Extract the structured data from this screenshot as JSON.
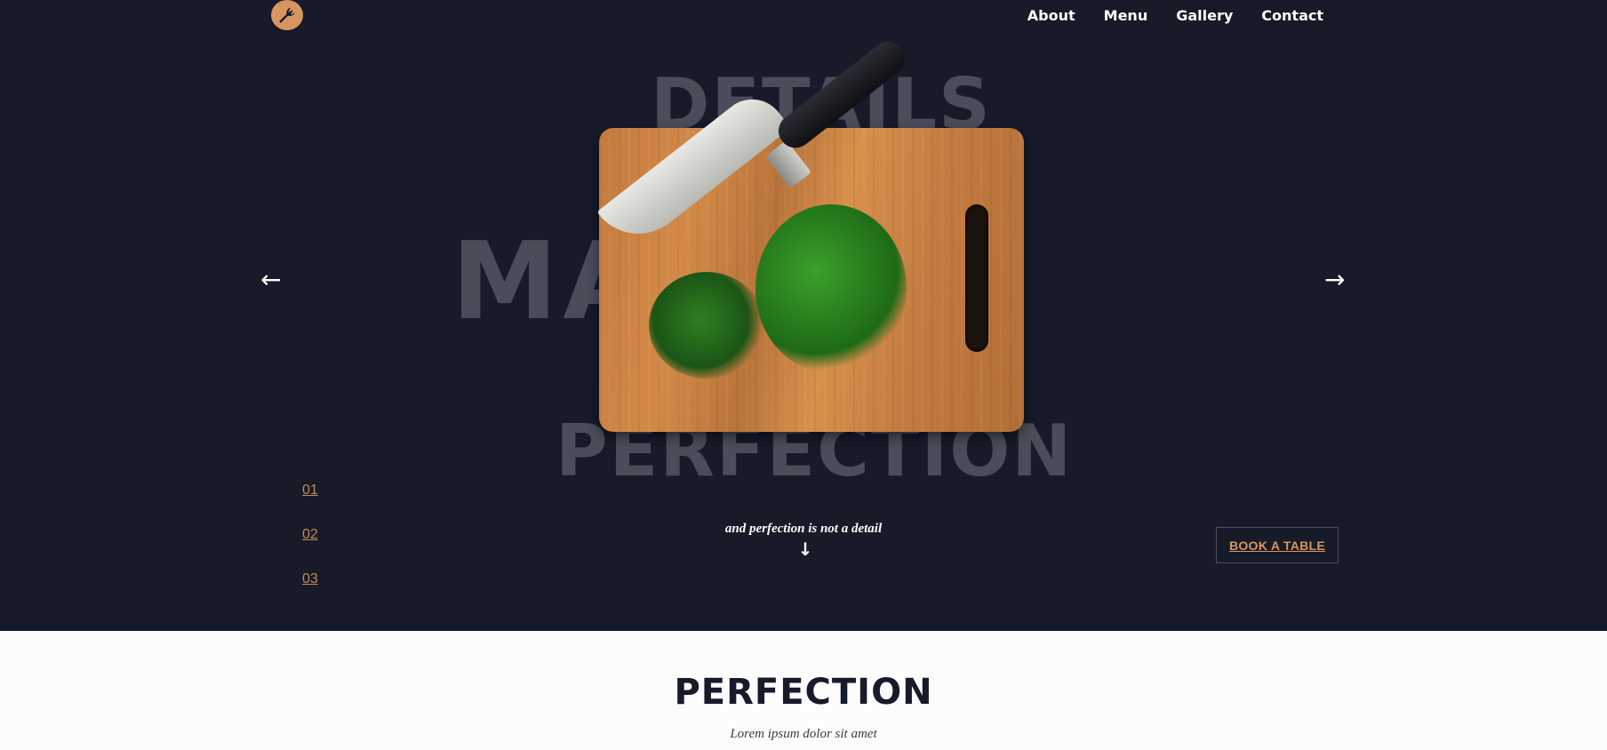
{
  "header": {
    "logo_icon": "fork-icon",
    "nav": [
      {
        "label": "About"
      },
      {
        "label": "Menu"
      },
      {
        "label": "Gallery"
      },
      {
        "label": "Contact"
      }
    ]
  },
  "hero": {
    "background_words": [
      "DETAILS",
      "MAKE",
      "PERFECTION"
    ],
    "image_subject": "cutting-board-with-knife-and-herbs",
    "prev_arrow": "←",
    "next_arrow": "→",
    "slides": [
      {
        "label": "01"
      },
      {
        "label": "02"
      },
      {
        "label": "03"
      }
    ],
    "tagline": "and perfection is not a detail",
    "scroll_arrow": "↓",
    "cta_label": "BOOK A TABLE"
  },
  "section": {
    "title": "PERFECTION",
    "subtitle": "Lorem ipsum dolor sit amet"
  },
  "colors": {
    "hero_bg": "#161a29",
    "accent": "#d8955f",
    "bg_word": "#4a4c59",
    "page_bg": "#fcfcfd"
  }
}
